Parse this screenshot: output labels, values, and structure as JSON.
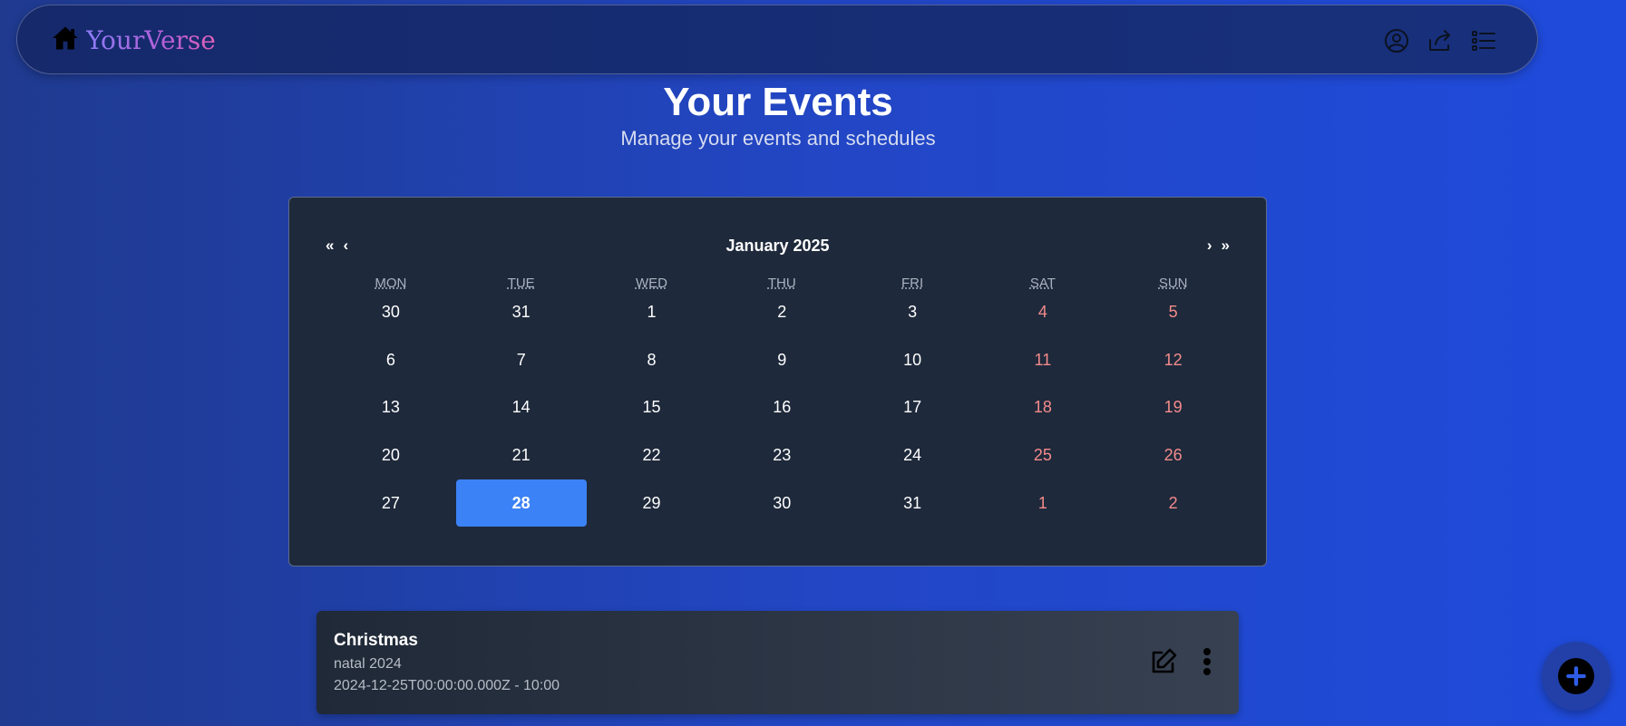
{
  "navbar": {
    "brand": "YourVerse",
    "icons": [
      "home-icon",
      "user-circle-icon",
      "share-icon",
      "list-icon"
    ]
  },
  "header": {
    "title": "Your Events",
    "subtitle": "Manage your events and schedules"
  },
  "calendar": {
    "month_label": "January 2025",
    "nav": {
      "prev_year": "«",
      "prev_month": "‹",
      "next_month": "›",
      "next_year": "»"
    },
    "weekdays": [
      "MON",
      "TUE",
      "WED",
      "THU",
      "FRI",
      "SAT",
      "SUN"
    ],
    "days": [
      {
        "label": "30",
        "weekend": false
      },
      {
        "label": "31",
        "weekend": false
      },
      {
        "label": "1",
        "weekend": false
      },
      {
        "label": "2",
        "weekend": false
      },
      {
        "label": "3",
        "weekend": false
      },
      {
        "label": "4",
        "weekend": true
      },
      {
        "label": "5",
        "weekend": true
      },
      {
        "label": "6",
        "weekend": false
      },
      {
        "label": "7",
        "weekend": false
      },
      {
        "label": "8",
        "weekend": false
      },
      {
        "label": "9",
        "weekend": false
      },
      {
        "label": "10",
        "weekend": false
      },
      {
        "label": "11",
        "weekend": true
      },
      {
        "label": "12",
        "weekend": true
      },
      {
        "label": "13",
        "weekend": false
      },
      {
        "label": "14",
        "weekend": false
      },
      {
        "label": "15",
        "weekend": false
      },
      {
        "label": "16",
        "weekend": false
      },
      {
        "label": "17",
        "weekend": false
      },
      {
        "label": "18",
        "weekend": true
      },
      {
        "label": "19",
        "weekend": true
      },
      {
        "label": "20",
        "weekend": false
      },
      {
        "label": "21",
        "weekend": false
      },
      {
        "label": "22",
        "weekend": false
      },
      {
        "label": "23",
        "weekend": false
      },
      {
        "label": "24",
        "weekend": false
      },
      {
        "label": "25",
        "weekend": true
      },
      {
        "label": "26",
        "weekend": true
      },
      {
        "label": "27",
        "weekend": false
      },
      {
        "label": "28",
        "weekend": false,
        "today": true
      },
      {
        "label": "29",
        "weekend": false
      },
      {
        "label": "30",
        "weekend": false
      },
      {
        "label": "31",
        "weekend": false
      },
      {
        "label": "1",
        "weekend": true
      },
      {
        "label": "2",
        "weekend": true
      }
    ],
    "colors": {
      "selected": "#3b82f6",
      "weekend": "#f48b8b",
      "background": "#1e293b"
    }
  },
  "events": [
    {
      "title": "Christmas",
      "description": "natal 2024",
      "time": "2024-12-25T00:00:00.000Z - 10:00"
    }
  ],
  "fab": {
    "icon": "plus-icon"
  }
}
